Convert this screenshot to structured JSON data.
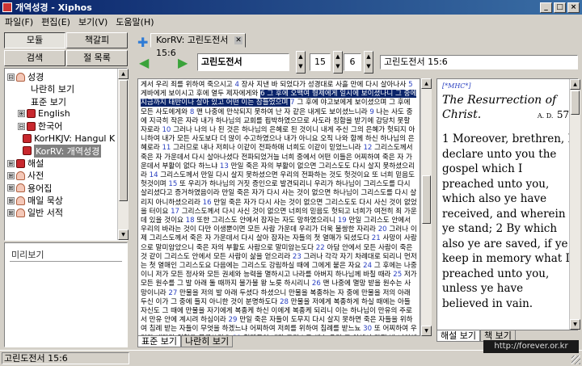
{
  "window": {
    "title": "개역성경 - Xiphos"
  },
  "menu": [
    "파일(F)",
    "편집(E)",
    "보기(V)",
    "도움말(H)"
  ],
  "side_buttons": {
    "modules": "모듈",
    "bookmarks": "책갈피",
    "search": "검색",
    "verse_list": "절 목록"
  },
  "tree": [
    {
      "label": "성경",
      "expander": "⊟",
      "icon": "fold",
      "indent": 0
    },
    {
      "label": "나란히 보기",
      "expander": "",
      "icon": "",
      "indent": 2
    },
    {
      "label": "표준 보기",
      "expander": "",
      "icon": "",
      "indent": 2
    },
    {
      "label": "English",
      "expander": "⊞",
      "icon": "book",
      "indent": 1
    },
    {
      "label": "한국어",
      "expander": "⊟",
      "icon": "book",
      "indent": 1
    },
    {
      "label": "KorHKJV: Hangul K",
      "expander": "",
      "icon": "book",
      "indent": 3
    },
    {
      "label": "KorRV: 개역성경",
      "expander": "",
      "icon": "book",
      "indent": 3,
      "selected": true
    },
    {
      "label": "해설",
      "expander": "⊞",
      "icon": "book",
      "indent": 0
    },
    {
      "label": "사전",
      "expander": "⊞",
      "icon": "fold",
      "indent": 0
    },
    {
      "label": "용어집",
      "expander": "⊞",
      "icon": "fold",
      "indent": 0
    },
    {
      "label": "매일 묵상",
      "expander": "⊞",
      "icon": "fold",
      "indent": 0
    },
    {
      "label": "일반 서적",
      "expander": "⊞",
      "icon": "fold",
      "indent": 0
    }
  ],
  "preview_label": "미리보기",
  "tab": {
    "label": "KorRV: 고린도전서 15:6"
  },
  "nav": {
    "book": "고린도전서",
    "chapter": "15",
    "verse": "6",
    "reference": "고린도전서 15:6"
  },
  "text_segments": [
    {
      "t": "게서 우리 죄를 위하여 죽으시고 "
    },
    {
      "v": "4"
    },
    {
      "t": " 장사 지낸 바 되었다가 성경대로 사흘 만에 다시 살아나사 "
    },
    {
      "v": "5"
    },
    {
      "t": " 게바에게 보이시고 후에 열두 제자에게와 "
    },
    {
      "v": "6",
      "hl": true
    },
    {
      "t": " 그 후에 오백여 형제에게 일시에 보이셨나니 그 중에 지금까지 태반이나 살아 있고 어떤 이는 잠들었으며 ",
      "hl": true
    },
    {
      "v": "7"
    },
    {
      "t": " 그 후에 야고보에게 보이셨으며 그 후에 모든 사도에게와 "
    },
    {
      "v": "8"
    },
    {
      "t": " 맨 나중에 만삭되지 못하여 난 자 같은 내게도 보이셨느니라 "
    },
    {
      "v": "9"
    },
    {
      "t": " 나는 사도 중에 지극히 작은 자라 내가 하나님의 교회를 핍박하였으므로 사도라 칭함을 받기에 감당치 못할 자로라 "
    },
    {
      "v": "10"
    },
    {
      "t": " 그러나 나의 나 된 것은 하나님의 은혜로 된 것이니 내게 주신 그의 은혜가 헛되지 아니하여 내가 모든 사도보다 더 많이 수고하였으나 내가 아니요 오직 나와 함께 하신 하나님의 은혜로라 "
    },
    {
      "v": "11"
    },
    {
      "t": " 그러므로 내나 저희나 이같이 전파하매 너희도 이같이 믿었느니라 "
    },
    {
      "v": "12"
    },
    {
      "t": " 그리스도께서 죽은 자 가운데서 다시 살아나셨다 전파되었거늘 너희 중에서 어떤 이들은 어찌하여 죽은 자 가운데서 부활이 없다 하느냐 "
    },
    {
      "v": "13"
    },
    {
      "t": " 만일 죽은 자의 부활이 없으면 그리스도도 다시 살지 못하셨으리라 "
    },
    {
      "v": "14"
    },
    {
      "t": " 그리스도께서 만일 다시 살지 못하셨으면 우리의 전파하는 것도 헛것이요 또 너희 믿음도 헛것이며 "
    },
    {
      "v": "15"
    },
    {
      "t": " 또 우리가 하나님의 거짓 증인으로 발견되리니 우리가 하나님이 그리스도를 다시 살리셨다고 증거하였음이라 만일 죽은 자가 다시 사는 것이 없으면 하나님이 그리스도를 다시 살리지 아니하셨으리라 "
    },
    {
      "v": "16"
    },
    {
      "t": " 만일 죽은 자가 다시 사는 것이 없으면 그리스도도 다시 사신 것이 없었을 터이요 "
    },
    {
      "v": "17"
    },
    {
      "t": " 그리스도께서 다시 사신 것이 없으면 너희의 믿음도 헛되고 너희가 여전히 죄 가운데 있을 것이요 "
    },
    {
      "v": "18"
    },
    {
      "t": " 또한 그리스도 안에서 잠자는 자도 망하였으리니 "
    },
    {
      "v": "19"
    },
    {
      "t": " 만일 그리스도 안에서 우리의 바라는 것이 다만 이생뿐이면 모든 사람 가운데 우리가 더욱 불쌍한 자리라 "
    },
    {
      "v": "20"
    },
    {
      "t": " 그러나 이제 그리스도께서 죽은 자 가운데서 다시 살아 잠자는 자들의 첫 열매가 되셨도다 "
    },
    {
      "v": "21"
    },
    {
      "t": " 사망이 사람으로 말미암았으니 죽은 자의 부활도 사람으로 말미암는도다 "
    },
    {
      "v": "22"
    },
    {
      "t": " 아담 안에서 모든 사람이 죽은 것 같이 그리스도 안에서 모든 사람이 삶을 얻으리라 "
    },
    {
      "v": "23"
    },
    {
      "t": " 그러나 각각 자기 차례대로 되리니 먼저는 첫 열매인 그리스도요 다음에는 그리스도 강림하실 때에 그에게 붙은 자요 "
    },
    {
      "v": "24"
    },
    {
      "t": " 그 후에는 나중이니 저가 모든 정사와 모든 권세와 능력을 멸하시고 나라를 아버지 하나님께 바칠 때라 "
    },
    {
      "v": "25"
    },
    {
      "t": " 저가 모든 원수를 그 발 아래 둘 때까지 불가불 왕 노릇 하시리니 "
    },
    {
      "v": "26"
    },
    {
      "t": " 맨 나중에 멸망 받을 원수는 사망이니라 "
    },
    {
      "v": "27"
    },
    {
      "t": " 만물을 저의 발 아래 두셨다 하셨으니 만물을 복종하는 자 중에 만물을 저의 아래 두신 이가 그 중에 들지 아니한 것이 분명하도다 "
    },
    {
      "v": "28"
    },
    {
      "t": " 만물을 저에게 복종하게 하실 때에는 아들 자신도 그 때에 만물을 자기에게 복종케 하신 이에게 복종케 되리니 이는 하나님이 만유의 주로서 만유 안에 계시려 하심이라 "
    },
    {
      "v": "29"
    },
    {
      "t": " 만일 죽은 자들이 도무지 다시 살지 못하면 죽은 자들을 위하여 침례 받는 자들이 무엇을 하겠느냐 어찌하여 저희를 위하여 침례를 받느뇨 "
    },
    {
      "v": "30"
    },
    {
      "t": " 또 어찌하여 우리가 때마다 위험을 무릅쓰리요 "
    },
    {
      "v": "31"
    },
    {
      "t": " 형제들아 내가 그리스도 예수 우리 주 안에서 가진 바 너희에게 대한 나의 자랑을 두고 단언하노니 나는 날마다 죽노라 "
    },
    {
      "v": "32"
    },
    {
      "t": " 내가 범인처럼 에베소에서 맹수로 더불어 싸웠으면 내게 무슨 유익이 있느뇨 죽은 자가 다시 살지 못할 것이면 내일 죽을 터이니 먹고 마시자 하리라 "
    },
    {
      "v": "33"
    },
    {
      "t": " 속지 말라 악한 동무들은 선한 행실을 더럽히나니"
    }
  ],
  "text_tabs": [
    "표준 보기",
    "나란히 보기"
  ],
  "commentary": {
    "tag": "[*MHC*]",
    "title": "The Resurrection of Christ.",
    "ad": "A. D.",
    "year": "57.",
    "body": "1 Moreover, brethren, I declare unto you the gospel which I preached unto you, which also ye have received, and wherein ye stand;   2 By which also ye are saved, if ye keep in memory what I preached unto you, unless ye have believed in vain."
  },
  "commentary_tabs": [
    "해설 보기",
    "책 보기"
  ],
  "status": "고린도전서 15:6",
  "watermark": "http://forever.or.kr"
}
